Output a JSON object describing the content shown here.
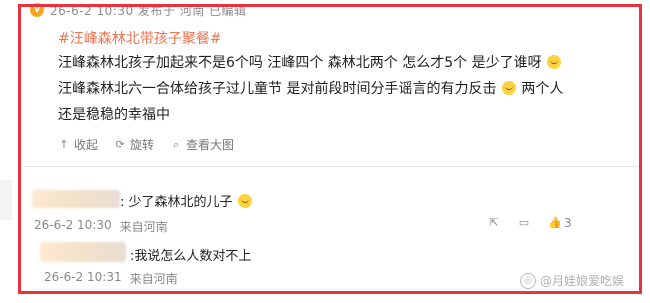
{
  "post": {
    "meta": "26-6-2 10:30 发布于 河南 已编辑",
    "hashtag": "#汪峰森林北带孩子聚餐#",
    "line1": "汪峰森林北孩子加起来不是6个吗 汪峰四个 森林北两个 怎么才5个 是少了谁呀",
    "line2": "汪峰森林北六一合体给孩子过儿童节 是对前段时间分手谣言的有力反击",
    "line2b": "两个人",
    "line3": "还是稳稳的幸福中",
    "actions": {
      "favorite": "收起",
      "repost": "旋转",
      "view_image": "查看大图"
    }
  },
  "comments": [
    {
      "text": ": 少了森林北的儿子",
      "time": "26-6-2 10:30",
      "location": "来自河南",
      "like_count": "3"
    },
    {
      "text": ":我说怎么人数对不上",
      "time": "26-6-2 10:31",
      "location": "来自河南"
    }
  ],
  "watermark": "@月娃娘爱吃娱"
}
